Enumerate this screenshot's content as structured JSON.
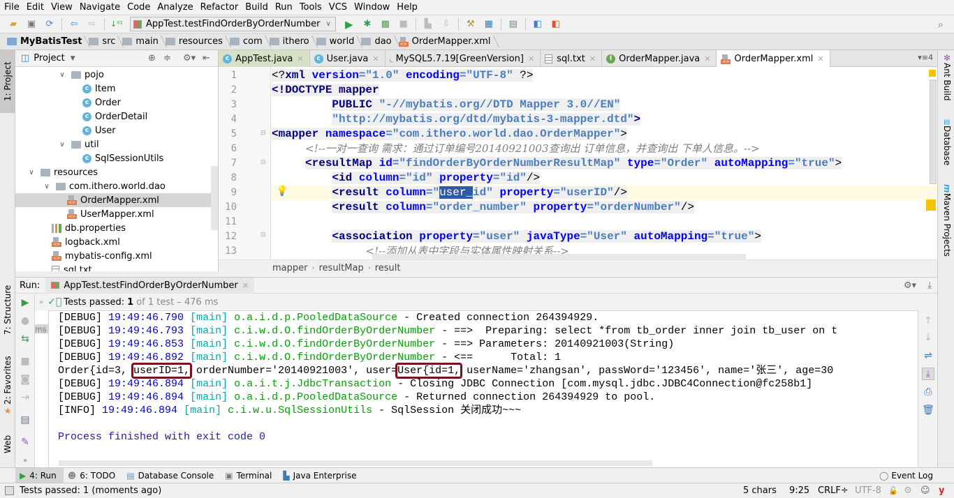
{
  "menu": [
    "File",
    "Edit",
    "View",
    "Navigate",
    "Code",
    "Analyze",
    "Refactor",
    "Build",
    "Run",
    "Tools",
    "VCS",
    "Window",
    "Help"
  ],
  "toolbar": {
    "run_config": "AppTest.testFindOrderByOrderNumber",
    "icons": [
      "open-folder-icon",
      "save-icon",
      "sync-icon",
      "back-icon",
      "forward-icon",
      "sort-icon",
      "run-icon",
      "debug-icon",
      "coverage-icon",
      "stop-icon",
      "build-icon",
      "deploy-icon",
      "settings-icon",
      "project-structure-icon",
      "sdk-icon",
      "translate-blue-icon",
      "translate-red-icon",
      "search-icon"
    ]
  },
  "navbar": [
    "MyBatisTest",
    "src",
    "main",
    "resources",
    "com",
    "ithero",
    "world",
    "dao",
    "OrderMapper.xml"
  ],
  "left_strip": {
    "project": "1: Project",
    "structure": "7: Structure",
    "favorites": "2: Favorites",
    "web": "Web"
  },
  "right_strip": {
    "ant": "Ant Build",
    "database": "Database",
    "maven": "Maven Projects"
  },
  "project_panel": {
    "title": "Project",
    "tree": [
      {
        "label": "pojo",
        "type": "folder",
        "level": 3,
        "expanded": true
      },
      {
        "label": "Item",
        "type": "class",
        "level": 4
      },
      {
        "label": "Order",
        "type": "class",
        "level": 4
      },
      {
        "label": "OrderDetail",
        "type": "class",
        "level": 4
      },
      {
        "label": "User",
        "type": "class",
        "level": 4
      },
      {
        "label": "util",
        "type": "folder",
        "level": 3,
        "expanded": true
      },
      {
        "label": "SqlSessionUtils",
        "type": "class",
        "level": 4
      },
      {
        "label": "resources",
        "type": "resfolder",
        "level": 1,
        "expanded": true
      },
      {
        "label": "com.ithero.world.dao",
        "type": "folder",
        "level": 2,
        "expanded": true
      },
      {
        "label": "OrderMapper.xml",
        "type": "xml",
        "level": 3,
        "selected": true
      },
      {
        "label": "UserMapper.xml",
        "type": "xml",
        "level": 3
      },
      {
        "label": "db.properties",
        "type": "props",
        "level": 2
      },
      {
        "label": "logback.xml",
        "type": "xml",
        "level": 2
      },
      {
        "label": "mybatis-config.xml",
        "type": "xml",
        "level": 2
      },
      {
        "label": "sql.txt",
        "type": "txt",
        "level": 2
      }
    ]
  },
  "editor_tabs": [
    {
      "label": "AppTest.java",
      "icon": "class-test-icon"
    },
    {
      "label": "User.java",
      "icon": "class-icon"
    },
    {
      "label": "MySQL5.7.19[GreenVersion]",
      "icon": "mysql-icon"
    },
    {
      "label": "sql.txt",
      "icon": "text-file-icon"
    },
    {
      "label": "OrderMapper.java",
      "icon": "interface-icon"
    },
    {
      "label": "OrderMapper.xml",
      "icon": "xml-file-icon",
      "active": true
    }
  ],
  "tabs_overflow": "4",
  "code_lines": [
    {
      "n": "1"
    },
    {
      "n": "2"
    },
    {
      "n": "3"
    },
    {
      "n": "4"
    },
    {
      "n": "5"
    },
    {
      "n": "6"
    },
    {
      "n": "7"
    },
    {
      "n": "8"
    },
    {
      "n": "9"
    },
    {
      "n": "10"
    },
    {
      "n": "11"
    },
    {
      "n": "12"
    },
    {
      "n": "13"
    }
  ],
  "code": {
    "l1": [
      "<?",
      "xml",
      " version",
      "=\"1.0\"",
      " encoding",
      "=\"UTF-8\"",
      " ?>"
    ],
    "l2": [
      "<!DOCTYPE",
      " mapper"
    ],
    "l3": [
      "PUBLIC",
      " \"-//mybatis.org//DTD Mapper 3.0//EN\""
    ],
    "l4": [
      "\"http://mybatis.org/dtd/mybatis-3-mapper.dtd\"",
      ">"
    ],
    "l5": [
      "<mapper",
      " namespace",
      "=\"com.ithero.world.dao.OrderMapper\"",
      ">"
    ],
    "l6": "<!--一对一查询 需求：通过订单编号20140921003查询出 订单信息，并查询出 下单人信息。-->",
    "l7": [
      "<resultMap",
      " id",
      "=\"findOrderByOrderNumberResultMap\"",
      " type",
      "=\"Order\"",
      " autoMapping",
      "=\"true\"",
      ">"
    ],
    "l8": [
      "<id",
      " column",
      "=\"id\"",
      " property",
      "=\"id\"",
      "/>"
    ],
    "l9": [
      "<result",
      " column",
      "=\"",
      "user_",
      "id\"",
      " property",
      "=\"userID\"",
      "/>"
    ],
    "l10": [
      "<result",
      " column",
      "=\"order_number\"",
      " property",
      "=\"orderNumber\"",
      "/>"
    ],
    "l12": [
      "<association",
      " property",
      "=\"user\"",
      " javaType",
      "=\"User\"",
      " autoMapping",
      "=\"true\"",
      ">"
    ],
    "l13": "<!--添加从表中字段与实体属性映射关系-->"
  },
  "editor_breadcrumb": [
    "mapper",
    "resultMap",
    "result"
  ],
  "run_panel": {
    "label": "Run:",
    "tab": "AppTest.testFindOrderByOrderNumber",
    "status_prefix": "Tests passed:",
    "status_count": "1",
    "status_suffix": "of 1 test – 476 ms",
    "test_tree": [
      "ms",
      "ms"
    ]
  },
  "console": [
    {
      "level": "[DEBUG]",
      "ts": "19:49:46.790",
      "thread": "[main]",
      "logger": "o.a.i.d.p.PooledDataSource",
      "msg": " - Created connection 264394929."
    },
    {
      "level": "[DEBUG]",
      "ts": "19:49:46.793",
      "thread": "[main]",
      "logger": "c.i.w.d.O.findOrderByOrderNumber",
      "msg": " - ==>  Preparing: select *from tb_order inner join tb_user on t"
    },
    {
      "level": "[DEBUG]",
      "ts": "19:49:46.853",
      "thread": "[main]",
      "logger": "c.i.w.d.O.findOrderByOrderNumber",
      "msg": " - ==> Parameters: 20140921003(String)"
    },
    {
      "level": "[DEBUG]",
      "ts": "19:49:46.892",
      "thread": "[main]",
      "logger": "c.i.w.d.O.findOrderByOrderNumber",
      "msg": " - <==      Total: 1"
    },
    {
      "level": "[DEBUG]",
      "ts": "19:49:46.894",
      "thread": "[main]",
      "logger": "o.a.i.t.j.JdbcTransaction",
      "msg": " - Closing JDBC Connection [com.mysql.jdbc.JDBC4Connection@fc258b1]"
    },
    {
      "level": "[DEBUG]",
      "ts": "19:49:46.894",
      "thread": "[main]",
      "logger": "o.a.i.d.p.PooledDataSource",
      "msg": " - Returned connection 264394929 to pool."
    },
    {
      "level": "[INFO]",
      "ts": "19:49:46.894",
      "thread": "[main]",
      "logger": "c.i.w.u.SqlSessionUtils",
      "msg": " - SqlSession 关闭成功~~~"
    }
  ],
  "result_line": {
    "p1": "Order{id=3, ",
    "h1": "userID=1,",
    "p2": " orderNumber='20140921003', user=",
    "h2": "User{id=1,",
    "p3": " userName='zhangsan', passWord='123456', name='张三', age=30"
  },
  "process_finished": "Process finished with exit code 0",
  "bottom_tabs": [
    {
      "label": "4: Run",
      "active": true
    },
    {
      "label": "6: TODO"
    },
    {
      "label": "Database Console"
    },
    {
      "label": "Terminal"
    },
    {
      "label": "Java Enterprise"
    }
  ],
  "event_log": "Event Log",
  "statusbar": {
    "message": "Tests passed: 1 (moments ago)",
    "chars": "5 chars",
    "position": "9:25",
    "line_sep": "CRLF÷",
    "encoding": "UTF-8"
  }
}
